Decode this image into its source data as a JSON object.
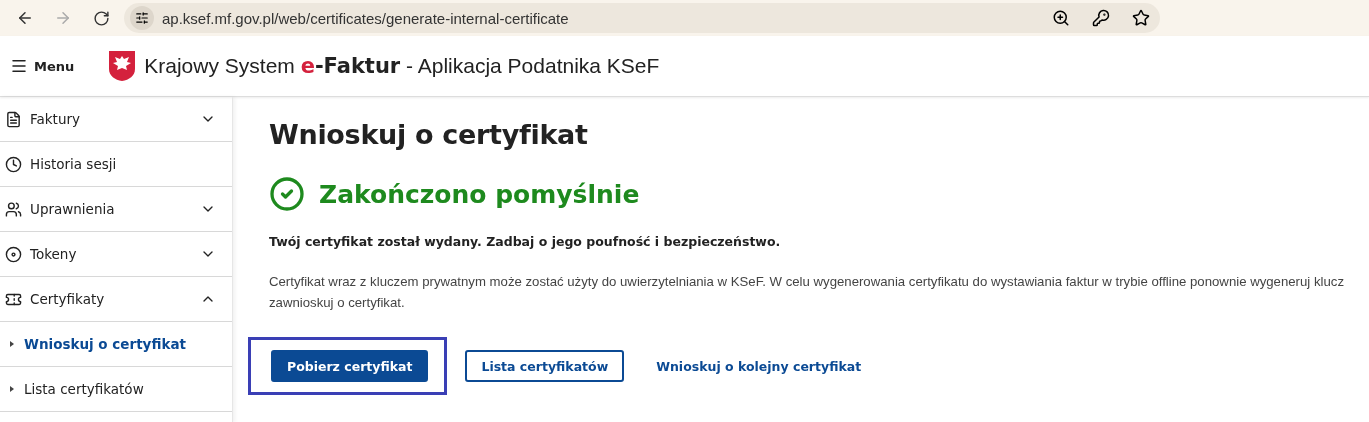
{
  "browser": {
    "url": "ap.ksef.mf.gov.pl/web/certificates/generate-internal-certificate"
  },
  "header": {
    "menu_label": "Menu",
    "title_prefix": "Krajowy System",
    "title_brand_e": "e",
    "title_brand_rest": "-Faktur",
    "title_suffix": "- Aplikacja Podatnika KSeF"
  },
  "sidebar": {
    "items": [
      {
        "kind": "group",
        "label": "Faktury",
        "expanded": false
      },
      {
        "kind": "group",
        "label": "Historia sesji"
      },
      {
        "kind": "group",
        "label": "Uprawnienia",
        "expanded": false
      },
      {
        "kind": "group",
        "label": "Tokeny",
        "expanded": false
      },
      {
        "kind": "group",
        "label": "Certyfikaty",
        "expanded": true
      },
      {
        "kind": "sub",
        "label": "Wnioskuj o certyfikat",
        "selected": true
      },
      {
        "kind": "sub",
        "label": "Lista certyfikatów",
        "selected": false
      }
    ]
  },
  "main": {
    "title": "Wnioskuj o certyfikat",
    "status": "Zakończono pomyślnie",
    "notice": "Twój certyfikat został wydany. Zadbaj o jego poufność i bezpieczeństwo.",
    "paragraph": "Certyfikat wraz z kluczem prywatnym może zostać użyty do uwierzytelniania w KSeF. W celu wygenerowania certyfikatu do wystawiania faktur w trybie offline ponownie wygeneruj klucz\nzawnioskuj o certyfikat.",
    "actions": [
      {
        "kind": "primary",
        "label": "Pobierz certyfikat",
        "highlighted": true
      },
      {
        "kind": "outline",
        "label": "Lista certyfikatów"
      },
      {
        "kind": "link",
        "label": "Wnioskuj o kolejny certyfikat"
      }
    ]
  }
}
